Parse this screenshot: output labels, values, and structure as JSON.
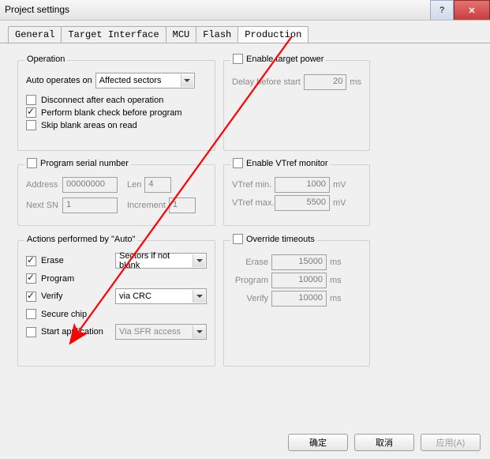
{
  "window": {
    "title": "Project settings"
  },
  "tabs": {
    "general": "General",
    "target_interface": "Target Interface",
    "mcu": "MCU",
    "flash": "Flash",
    "production": "Production"
  },
  "operation": {
    "title": "Operation",
    "auto_operates_label": "Auto operates on",
    "auto_operates_value": "Affected sectors",
    "disconnect_label": "Disconnect after each operation",
    "disconnect_checked": false,
    "blank_check_label": "Perform blank check before program",
    "blank_check_checked": true,
    "skip_blank_label": "Skip blank areas on read",
    "skip_blank_checked": false
  },
  "enable_target_power": {
    "title": "Enable target power",
    "checked": false,
    "delay_label": "Delay before start",
    "delay_value": "20",
    "delay_unit": "ms"
  },
  "serial": {
    "title": "Program serial number",
    "checked": false,
    "address_label": "Address",
    "address_value": "00000000",
    "next_sn_label": "Next SN",
    "next_sn_value": "1",
    "len_label": "Len",
    "len_value": "4",
    "increment_label": "Increment",
    "increment_value": "1"
  },
  "vtref": {
    "title": "Enable VTref monitor",
    "checked": false,
    "min_label": "VTref min.",
    "min_value": "1000",
    "max_label": "VTref max.",
    "max_value": "5500",
    "unit": "mV"
  },
  "actions": {
    "title": "Actions performed by \"Auto\"",
    "erase_label": "Erase",
    "erase_checked": true,
    "erase_mode": "Sectors if not blank",
    "program_label": "Program",
    "program_checked": true,
    "verify_label": "Verify",
    "verify_checked": true,
    "verify_mode": "via CRC",
    "secure_label": "Secure chip",
    "secure_checked": false,
    "start_app_label": "Start application",
    "start_app_checked": false,
    "start_app_mode": "Via SFR access"
  },
  "timeouts": {
    "title": "Override timeouts",
    "checked": false,
    "erase_label": "Erase",
    "erase_value": "15000",
    "program_label": "Program",
    "program_value": "10000",
    "verify_label": "Verify",
    "verify_value": "10000",
    "unit": "ms"
  },
  "buttons": {
    "ok": "确定",
    "cancel": "取消",
    "apply": "应用(A)"
  }
}
